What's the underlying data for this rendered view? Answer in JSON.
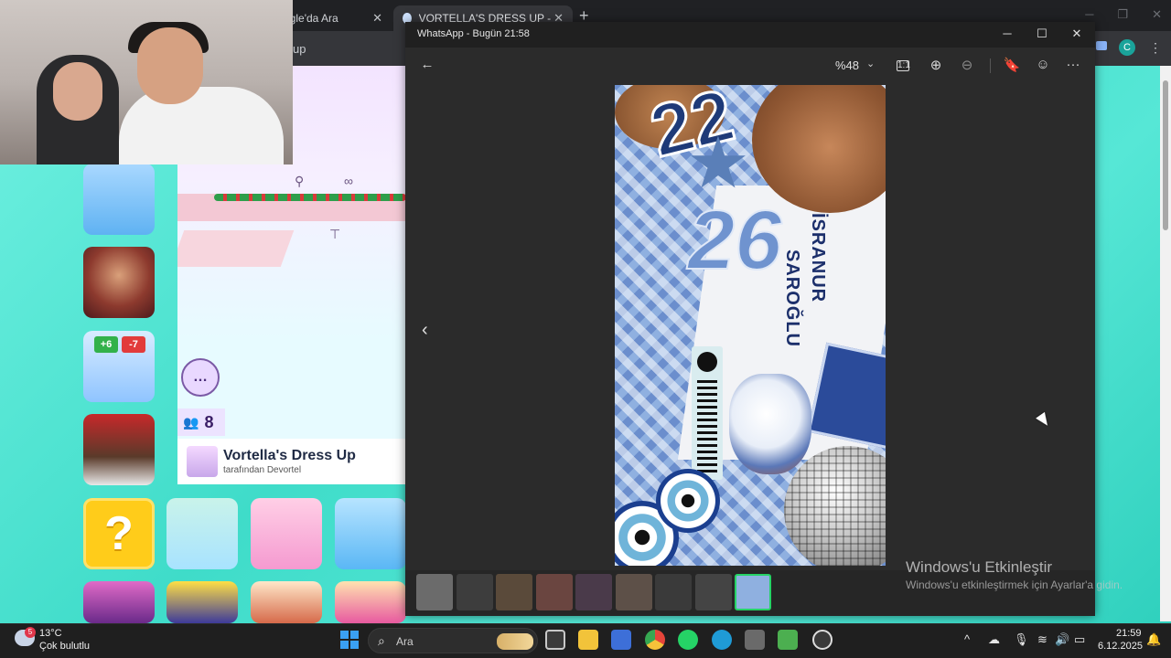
{
  "browser": {
    "tabs": [
      {
        "label": "ogle'da Ara",
        "close": "✕"
      },
      {
        "label": "VORTELLA'S DRESS UP - Ücretsi",
        "close": "✕"
      }
    ],
    "new_tab": "+",
    "address_fragment": "up",
    "profile_initial": "C",
    "menu": "⋮"
  },
  "website": {
    "chat_icon": "…",
    "player_count": "8",
    "game_title": "Vortella's Dress Up",
    "game_author": "tarafından Devortel",
    "mystery_tile": "?",
    "tile_plus": "+6",
    "tile_minus": "-7"
  },
  "whatsapp": {
    "title": "WhatsApp - Bugün 21:58",
    "zoom": "%48",
    "toolbar": {
      "back": "←",
      "zoom_chevron": "⌄",
      "actual_size": "1:1",
      "zoom_in": "⊕",
      "zoom_out": "⊖",
      "bookmark": "🔖",
      "emoji": "☺",
      "more": "···"
    },
    "win_controls": {
      "minimize": "─",
      "maximize": "☐",
      "close": "✕"
    },
    "nav_prev": "‹",
    "photo_text": {
      "number_top": "22",
      "number_mid": "26",
      "name_first": "İSRANUR",
      "name_last": "SAROĞLU"
    },
    "filmstrip_count": 9,
    "selected_index": 8
  },
  "watermark": {
    "line1": "Windows'u Etkinleştir",
    "line2": "Windows'u etkinleştirmek için Ayarlar'a gidin."
  },
  "taskbar": {
    "weather_badge": "5",
    "temperature": "13°C",
    "weather": "Çok bulutlu",
    "search_placeholder": "Ara",
    "time": "21:59",
    "date": "6.12.2025",
    "tray_chevron": "^",
    "colors": {
      "start": "#3aa0f3",
      "whatsapp": "#25d366",
      "edge": "#1f9bd6"
    }
  }
}
